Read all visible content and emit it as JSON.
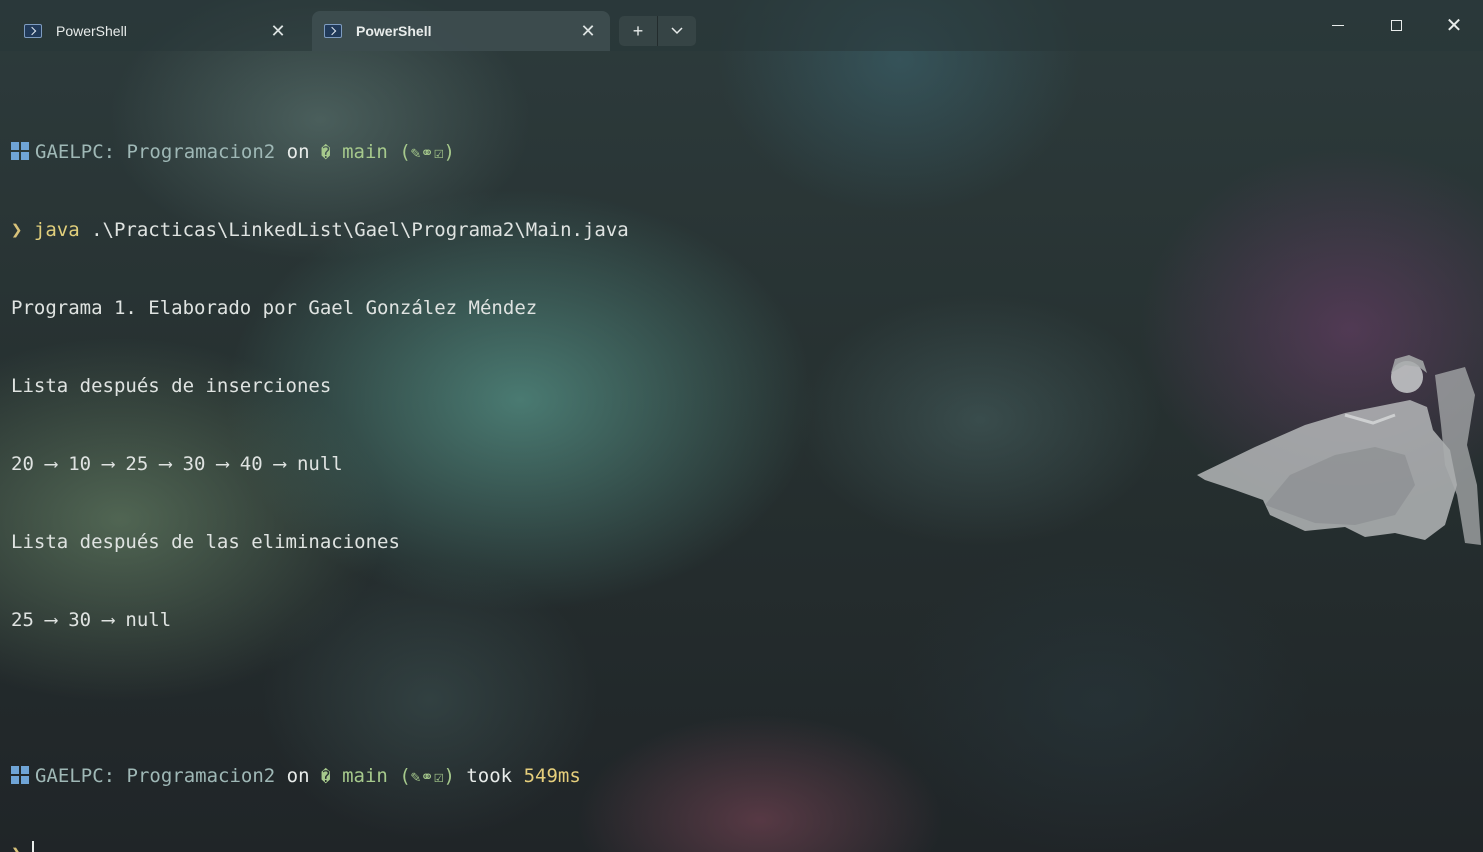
{
  "window": {
    "tabs": [
      {
        "label": "PowerShell",
        "active": false
      },
      {
        "label": "PowerShell",
        "active": true
      }
    ],
    "new_tab_glyph": "+",
    "dropdown_glyph": "⌄",
    "close_glyph": "✕"
  },
  "prompt": {
    "host": "GAELPC: Programacion2",
    "on": "on",
    "branch_icon": "�",
    "branch": "main",
    "status_open": "(",
    "status_icons": "✎⚭☑",
    "status_close": ")",
    "symbol": "❯"
  },
  "session": {
    "command": "java",
    "command_args": " .\\Practicas\\LinkedList\\Gael\\Programa2\\Main.java",
    "output": [
      "Programa 1. Elaborado por Gael González Méndez",
      "Lista después de inserciones",
      "20 ⟶ 10 ⟶ 25 ⟶ 30 ⟶ 40 ⟶ null",
      "Lista después de las eliminaciones",
      "25 ⟶ 30 ⟶ null"
    ],
    "took_label": "took",
    "duration": "549ms"
  },
  "colors": {
    "accent": "#a6c98c",
    "prompt": "#d8c27a",
    "windows_logo": "#6fa4d6"
  }
}
